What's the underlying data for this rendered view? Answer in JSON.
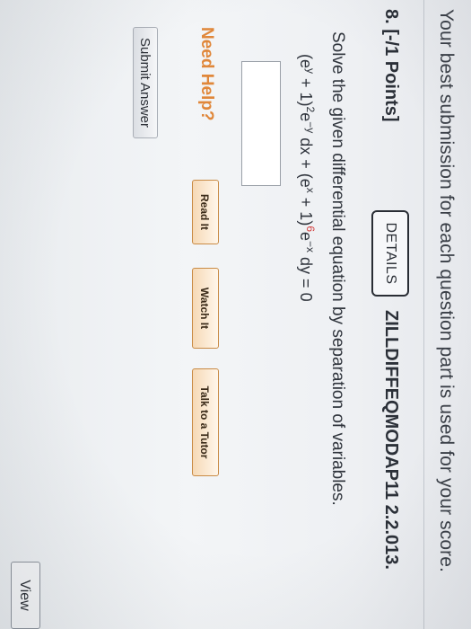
{
  "banner": "Your best submission for each question part is used for your score.",
  "question": {
    "number_points": "8. [-/1 Points]",
    "details_label": "DETAILS",
    "code": "ZILLDIFFEQMODAP11 2.2.013.",
    "prompt": "Solve the given differential equation by separation of variables.",
    "equation": {
      "part1": "(e",
      "sup_y": "y",
      "part2": " + 1)",
      "sup_2": "2",
      "part3": "e",
      "sup_negy": "−y",
      "part4": " dx + (e",
      "sup_x": "x",
      "part5": " + 1)",
      "sup_6": "6",
      "part6": "e",
      "sup_negx": "−x",
      "part7": " dy = 0"
    },
    "answer_value": ""
  },
  "help": {
    "label": "Need Help?",
    "read_it": "Read It",
    "watch_it": "Watch It",
    "talk_to_tutor": "Talk to a Tutor"
  },
  "submit_label": "Submit Answer",
  "view_label": "View",
  "colors": {
    "need_help": "#e0873a",
    "exponent_highlight": "#d23b3b",
    "help_button_border": "#c98b45"
  }
}
